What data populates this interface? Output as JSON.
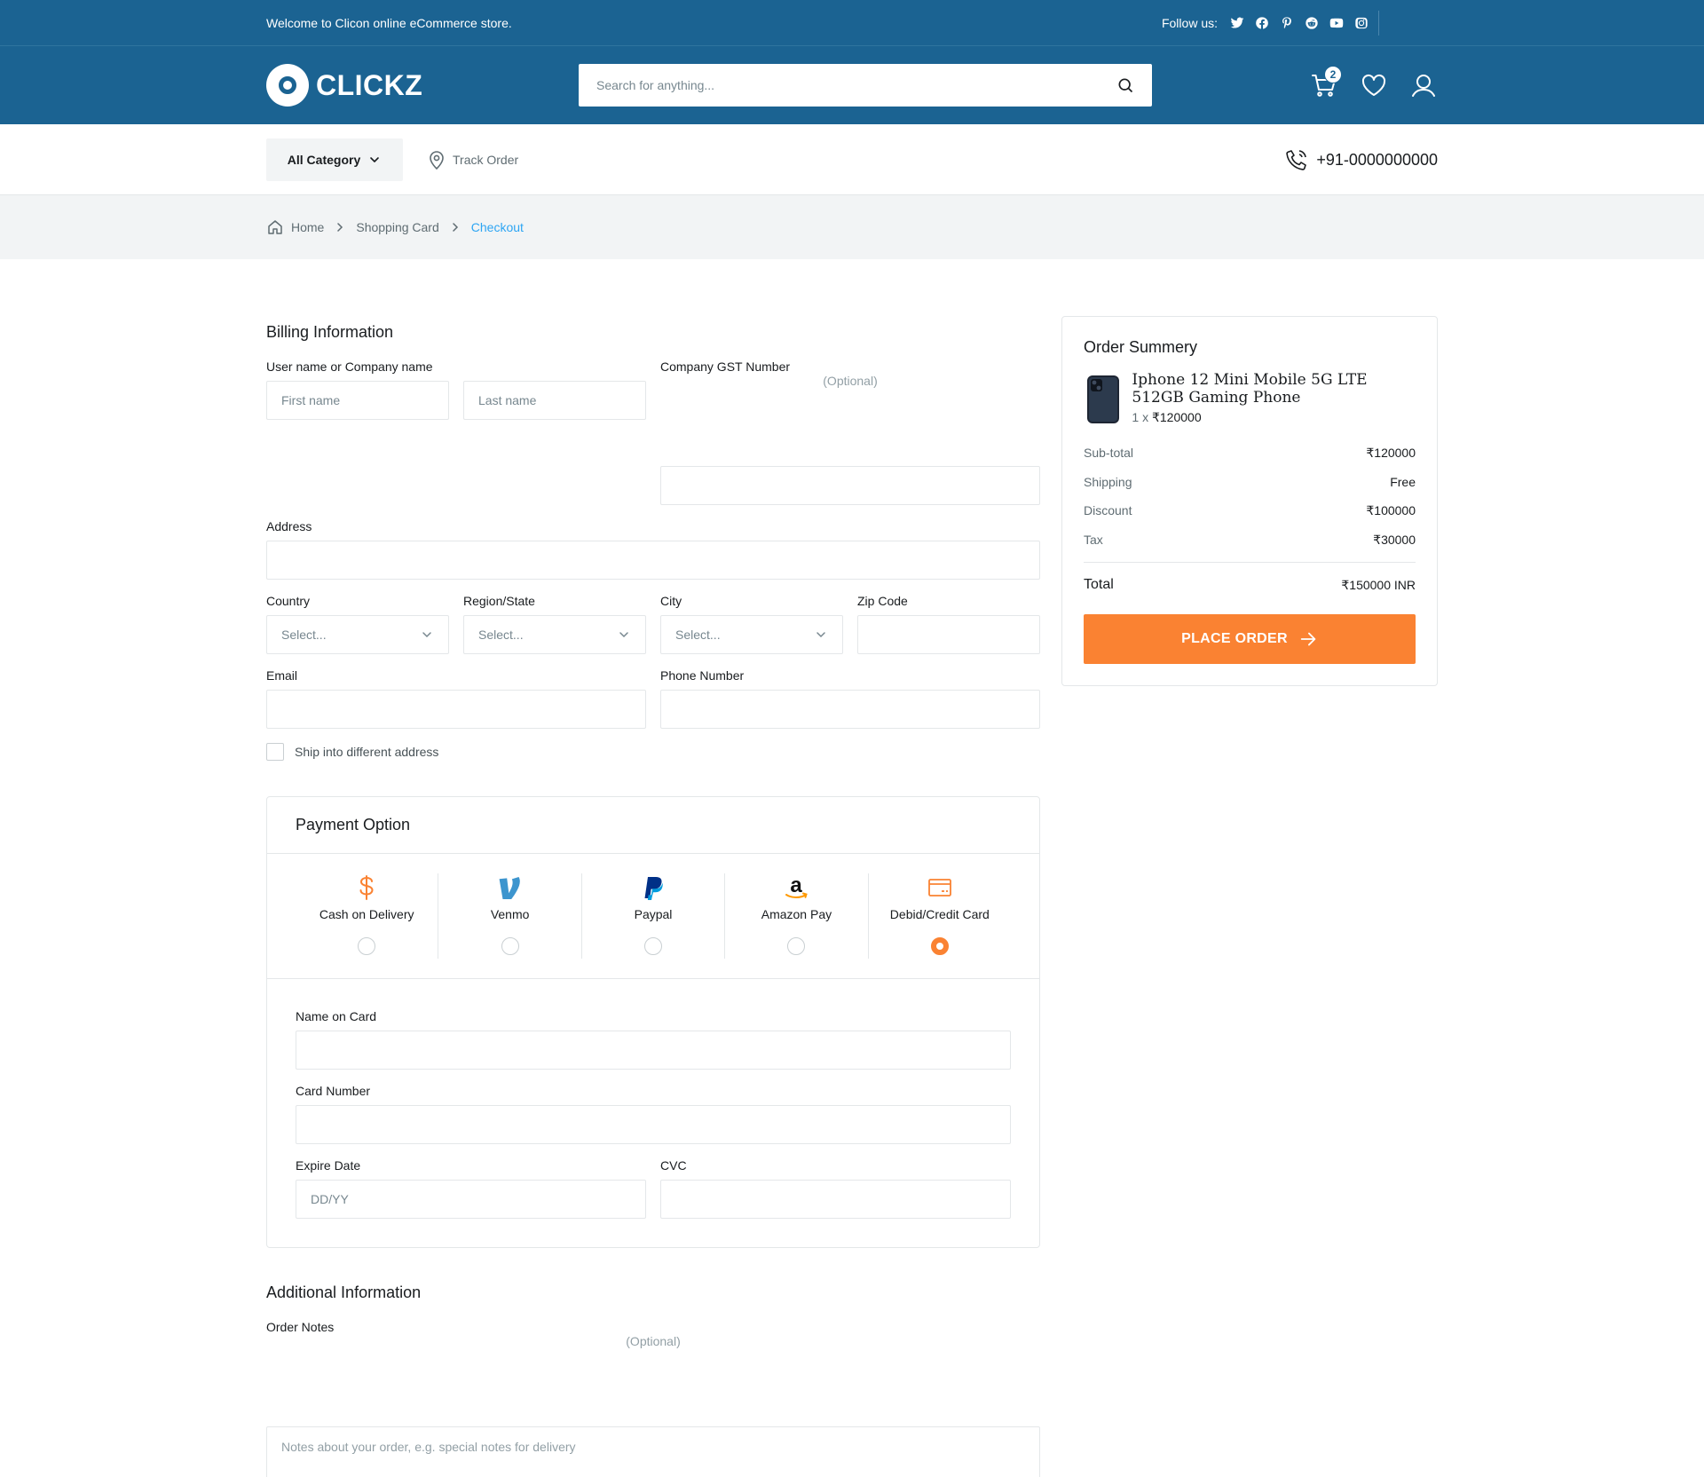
{
  "topbar": {
    "welcome": "Welcome to Clicon online eCommerce store.",
    "follow_label": "Follow us:",
    "socials": [
      "twitter-icon",
      "facebook-icon",
      "pinterest-icon",
      "reddit-icon",
      "youtube-icon",
      "instagram-icon"
    ]
  },
  "header": {
    "brand": "CLICKZ",
    "search_placeholder": "Search for anything...",
    "cart_count": "2"
  },
  "nav": {
    "all_category": "All Category",
    "track_order": "Track Order",
    "phone": "+91-0000000000"
  },
  "breadcrumb": {
    "home": "Home",
    "shopping_card": "Shopping Card",
    "current": "Checkout"
  },
  "billing": {
    "title": "Billing Information",
    "name_label": "User name or Company name",
    "first_placeholder": "First name",
    "last_placeholder": "Last name",
    "gst_label": "Company GST Number",
    "gst_optional": "(Optional)",
    "address_label": "Address",
    "country_label": "Country",
    "region_label": "Region/State",
    "city_label": "City",
    "zip_label": "Zip Code",
    "select_placeholder": "Select...",
    "email_label": "Email",
    "phone_label": "Phone Number",
    "ship_diff": "Ship into different address"
  },
  "payment": {
    "title": "Payment Option",
    "options": [
      {
        "label": "Cash on Delivery",
        "icon": "dollar-icon",
        "selected": false
      },
      {
        "label": "Venmo",
        "icon": "venmo-icon",
        "selected": false
      },
      {
        "label": "Paypal",
        "icon": "paypal-icon",
        "selected": false
      },
      {
        "label": "Amazon Pay",
        "icon": "amazon-icon",
        "selected": false
      },
      {
        "label": "Debid/Credit Card",
        "icon": "credit-card-icon",
        "selected": true
      }
    ],
    "name_on_card": "Name on Card",
    "card_number": "Card Number",
    "expire_date": "Expire Date",
    "expire_placeholder": "DD/YY",
    "cvc": "CVC"
  },
  "additional": {
    "title": "Additional Information",
    "notes_label": "Order Notes",
    "notes_optional": "(Optional)",
    "notes_placeholder": "Notes about your order, e.g. special notes for delivery"
  },
  "summary": {
    "title": "Order Summery",
    "product_name": "Iphone 12 Mini Mobile 5G LTE 512GB Gaming Phone",
    "product_qty": "1 x",
    "product_price": "₹120000",
    "subtotal_label": "Sub-total",
    "subtotal": "₹120000",
    "shipping_label": "Shipping",
    "shipping": "Free",
    "discount_label": "Discount",
    "discount": "₹100000",
    "tax_label": "Tax",
    "tax": "₹30000",
    "total_label": "Total",
    "total": "₹150000 INR",
    "place_order": "PLACE ORDER"
  },
  "colors": {
    "brand": "#1b6392",
    "accent": "#fa8232",
    "link": "#2da5f3"
  }
}
